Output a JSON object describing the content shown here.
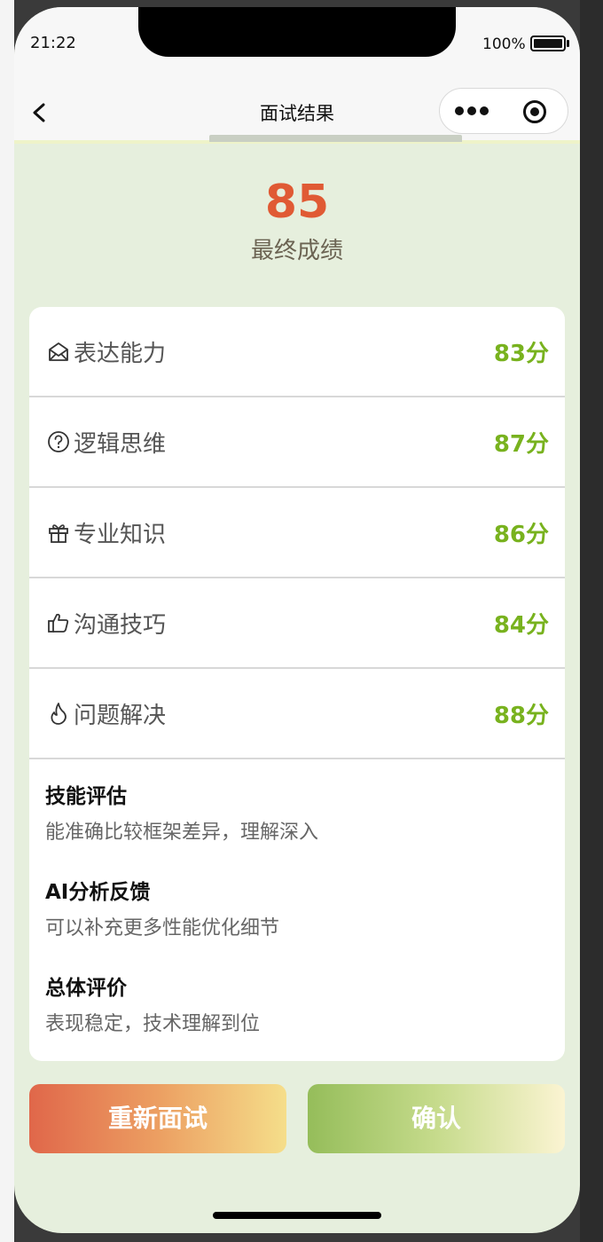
{
  "status": {
    "time": "21:22",
    "battery": "100%"
  },
  "nav": {
    "title": "面试结果"
  },
  "result": {
    "score": "85",
    "score_label": "最终成绩"
  },
  "dimensions": [
    {
      "icon": "envelope-icon",
      "label": "表达能力",
      "value": "83分"
    },
    {
      "icon": "question-circle-icon",
      "label": "逻辑思维",
      "value": "87分"
    },
    {
      "icon": "gift-icon",
      "label": "专业知识",
      "value": "86分"
    },
    {
      "icon": "thumbs-up-icon",
      "label": "沟通技巧",
      "value": "84分"
    },
    {
      "icon": "flame-icon",
      "label": "问题解决",
      "value": "88分"
    }
  ],
  "sections": [
    {
      "title": "技能评估",
      "text": "能准确比较框架差异，理解深入"
    },
    {
      "title": "AI分析反馈",
      "text": "可以补充更多性能优化细节"
    },
    {
      "title": "总体评价",
      "text": "表现稳定，技术理解到位"
    }
  ],
  "buttons": {
    "retry": "重新面试",
    "confirm": "确认"
  },
  "colors": {
    "score": "#e05a34",
    "value": "#78b21e",
    "background": "#e6efdd"
  }
}
